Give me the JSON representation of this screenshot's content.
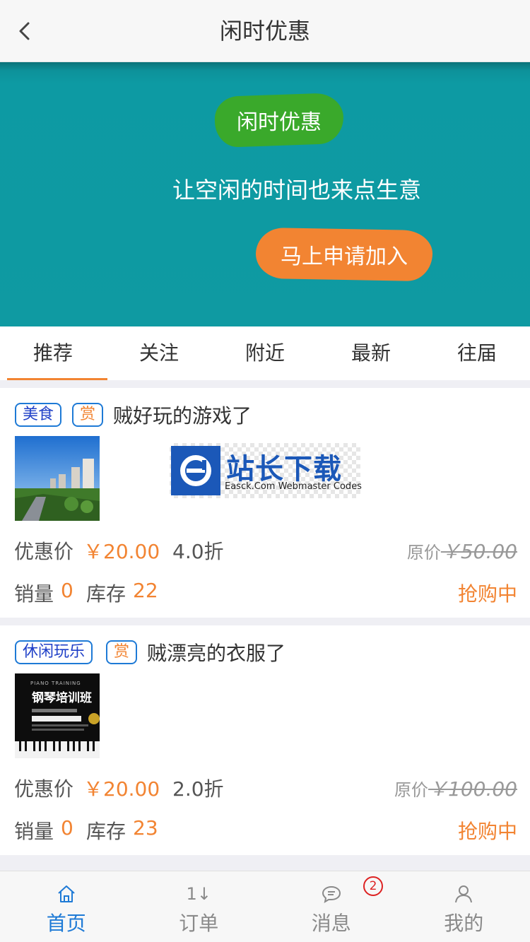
{
  "header": {
    "title": "闲时优惠",
    "back_icon": "chevron-left-icon"
  },
  "banner": {
    "badge_label": "闲时优惠",
    "slogan": "让空闲的时间也来点生意",
    "cta_label": "马上申请加入",
    "colors": {
      "background": "#0f9aa2",
      "badge": "#3aa92b",
      "cta": "#f28432"
    }
  },
  "tabs": [
    {
      "label": "推荐",
      "active": true
    },
    {
      "label": "关注"
    },
    {
      "label": "附近"
    },
    {
      "label": "最新"
    },
    {
      "label": "往届"
    }
  ],
  "deals": [
    {
      "tag": "美食",
      "reward_tag": "赏",
      "title": "贼好玩的游戏了",
      "price_label": "优惠价",
      "price": "￥20.00",
      "discount": "4.0折",
      "original_label": "原价",
      "original_price": "￥50.00",
      "sales_label": "销量",
      "sales": "0",
      "stock_label": "库存",
      "stock": "22",
      "status": "抢购中",
      "watermark": {
        "cn": "站长下载",
        "en": "Easck.Com Webmaster Codes"
      }
    },
    {
      "tag": "休闲玩乐",
      "reward_tag": "赏",
      "title": "贼漂亮的衣服了",
      "price_label": "优惠价",
      "price": "￥20.00",
      "discount": "2.0折",
      "original_label": "原价",
      "original_price": "￥100.00",
      "sales_label": "销量",
      "sales": "0",
      "stock_label": "库存",
      "stock": "23",
      "status": "抢购中",
      "thumb": {
        "en": "PIANO TRAINING",
        "cn": "钢琴培训班"
      }
    }
  ],
  "bottom_nav": [
    {
      "label": "首页",
      "icon": "home-icon",
      "active": true
    },
    {
      "label": "订单",
      "icon": "sort-arrows-icon",
      "glyph": "1↓"
    },
    {
      "label": "消息",
      "icon": "chat-bubble-icon",
      "badge": "2"
    },
    {
      "label": "我的",
      "icon": "user-icon"
    }
  ],
  "colors": {
    "accent": "#f28432",
    "primary": "#1e7ad6"
  }
}
